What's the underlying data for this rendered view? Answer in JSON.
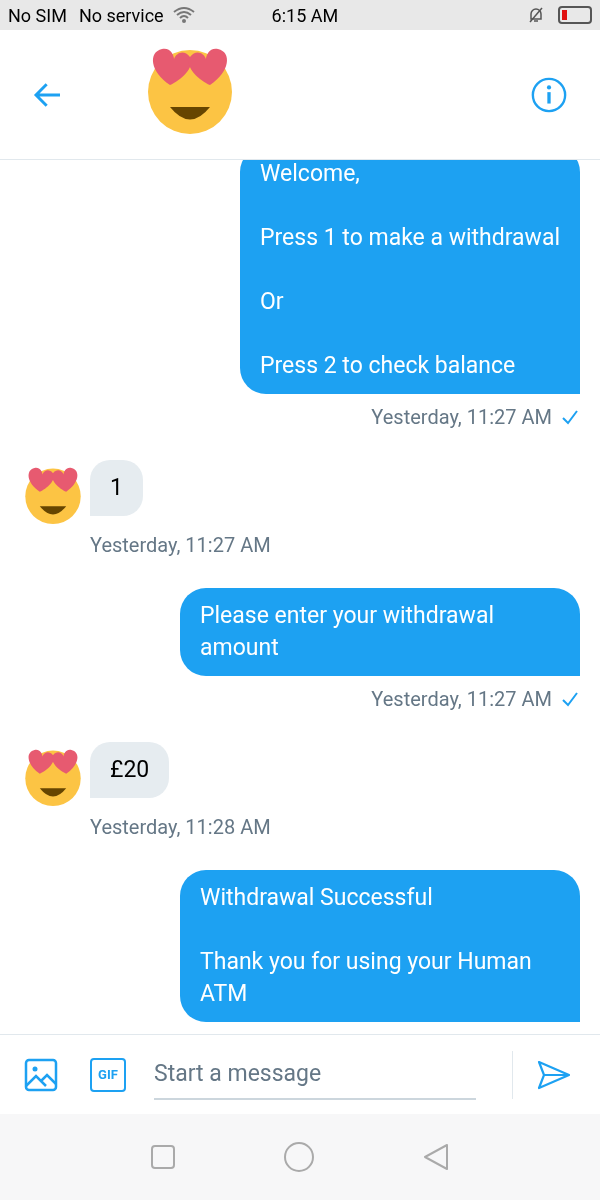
{
  "status_bar": {
    "carrier": "No SIM",
    "service": "No service",
    "time": "6:15 AM"
  },
  "composer": {
    "placeholder": "Start a message",
    "gif_label": "GIF"
  },
  "messages": [
    {
      "kind": "sent",
      "lines": [
        "Welcome,",
        "Press 1 to make a withdrawal",
        "Or",
        "Press 2 to check balance"
      ],
      "time": "Yesterday, 11:27 AM",
      "read": true
    },
    {
      "kind": "received",
      "lines": [
        "1"
      ],
      "time": "Yesterday, 11:27 AM"
    },
    {
      "kind": "sent",
      "lines": [
        "Please enter your withdrawal amount"
      ],
      "time": "Yesterday, 11:27 AM",
      "read": true
    },
    {
      "kind": "received",
      "lines": [
        "£20"
      ],
      "time": "Yesterday, 11:28 AM"
    },
    {
      "kind": "sent",
      "lines": [
        "Withdrawal Successful",
        "Thank you for using your Human ATM"
      ]
    }
  ]
}
